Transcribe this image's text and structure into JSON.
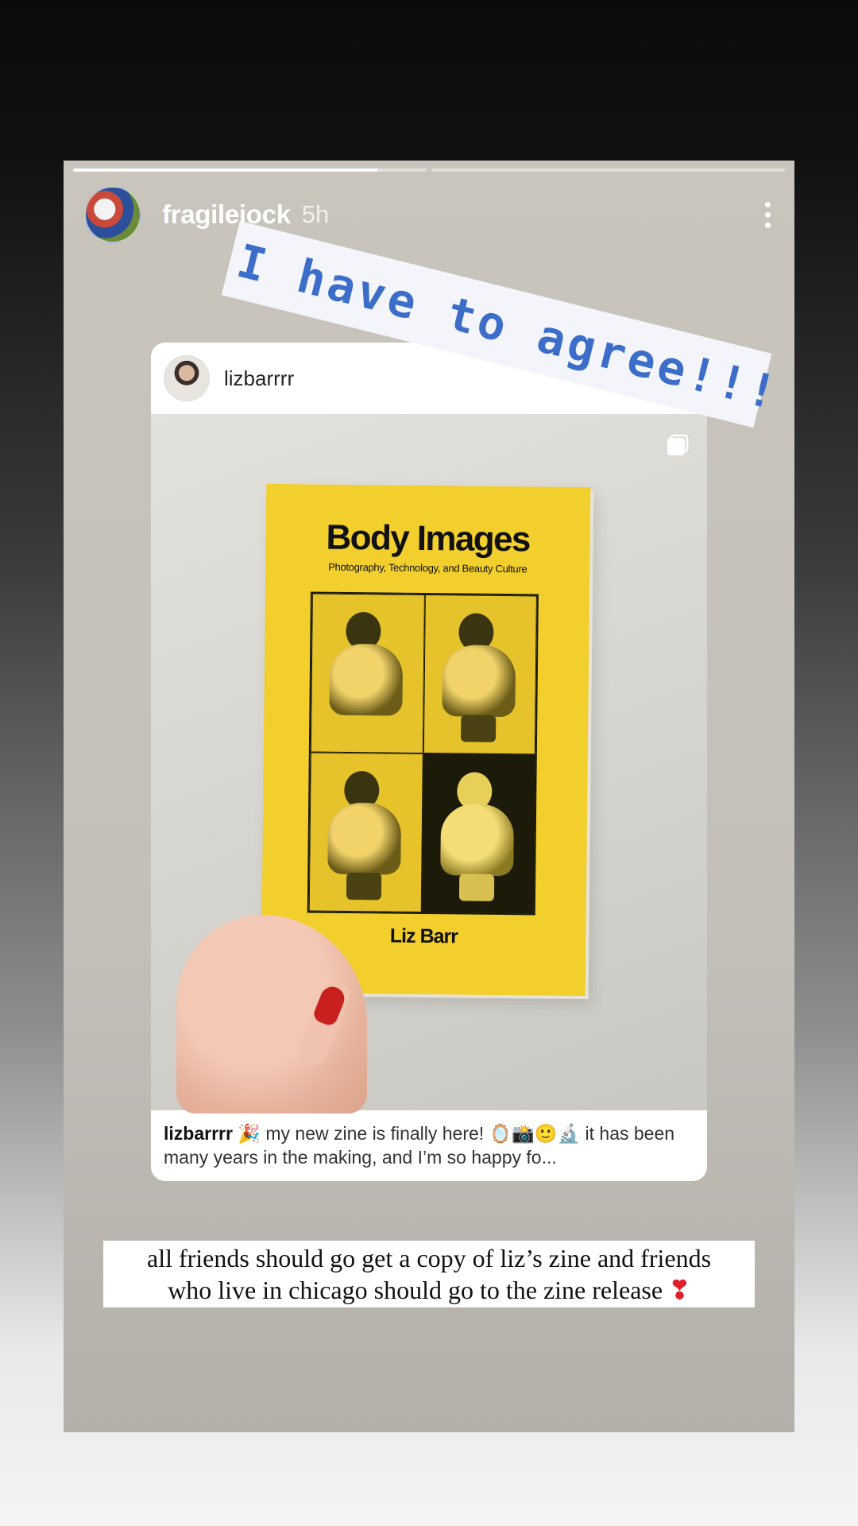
{
  "story": {
    "progress": [
      0.86,
      0
    ],
    "author": "fragilejock",
    "time": "5h",
    "sticker_text": "I have to agree!!!",
    "shared_post": {
      "username": "lizbarrrr",
      "zine": {
        "title": "Body Images",
        "subtitle": "Photography, Technology, and Beauty Culture",
        "author": "Liz Barr"
      },
      "caption_user": "lizbarrrr",
      "caption_text": " 🎉 my new zine is finally here! 🪞📸🙂🔬 it has been many years in the making, and I’m so happy fo..."
    },
    "text_sticker": {
      "line1": "all friends should go get a copy of liz’s zine and friends",
      "line2": "who live in chicago should go to the zine release",
      "emoji": "❣"
    }
  }
}
